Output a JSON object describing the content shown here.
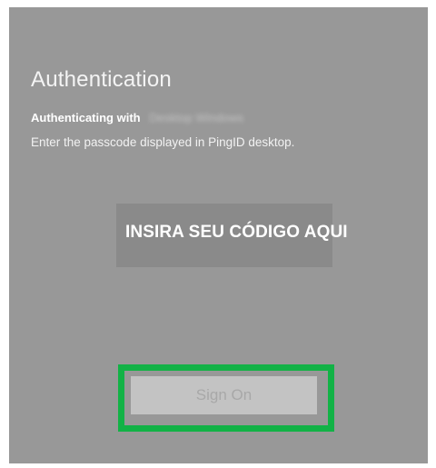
{
  "header": {
    "title": "Authentication"
  },
  "auth": {
    "authenticating_label": "Authenticating with",
    "device_name": "Desktop Windows",
    "instructions": "Enter the passcode displayed in PingID desktop."
  },
  "passcode": {
    "overlay_text": "INSIRA SEU CÓDIGO AQUI"
  },
  "actions": {
    "sign_on_label": "Sign On"
  },
  "colors": {
    "panel_bg": "#989898",
    "highlight_border": "#12b246",
    "button_bg": "#c3c3c3"
  }
}
